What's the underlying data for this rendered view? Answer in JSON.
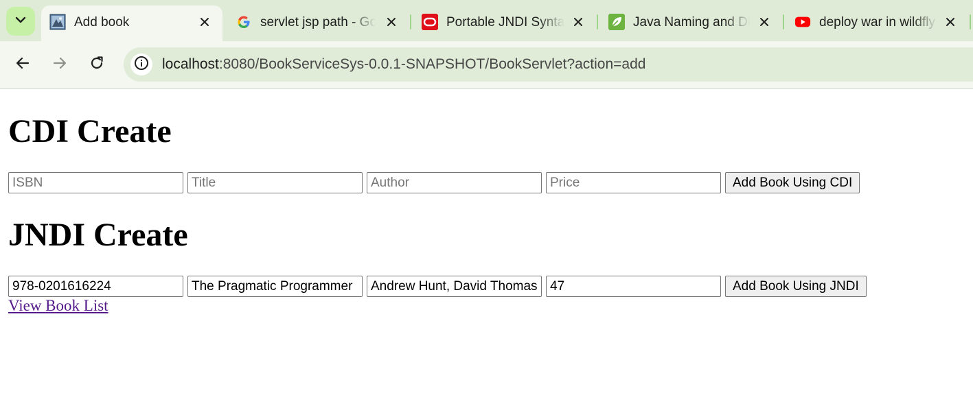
{
  "browser": {
    "tabs": [
      {
        "title": "Add book",
        "favicon": "page-favicon-icon",
        "active": true
      },
      {
        "title": "servlet jsp path - Google",
        "favicon": "google-favicon-icon",
        "active": false
      },
      {
        "title": "Portable JNDI Syntax",
        "favicon": "oracle-favicon-icon",
        "active": false
      },
      {
        "title": "Java Naming and Directory",
        "favicon": "spring-leaf-favicon-icon",
        "active": false
      },
      {
        "title": "deploy war in wildfly",
        "favicon": "youtube-favicon-icon",
        "active": false
      }
    ],
    "address": {
      "host": "localhost",
      "path": ":8080/BookServiceSys-0.0.1-SNAPSHOT/BookServlet?action=add"
    },
    "colors": {
      "tabstrip": "#dfebd6",
      "toolbar": "#f3f7ef",
      "omnibox": "#e0ebd8",
      "tab_search": "#c6f0a6",
      "separator": "#9fd58a"
    }
  },
  "page": {
    "cdi_heading": "CDI Create",
    "cdi_form": {
      "isbn_placeholder": "ISBN",
      "title_placeholder": "Title",
      "author_placeholder": "Author",
      "price_placeholder": "Price",
      "isbn_value": "",
      "title_value": "",
      "author_value": "",
      "price_value": "",
      "submit_label": "Add Book Using CDI"
    },
    "jndi_heading": "JNDI Create",
    "jndi_form": {
      "isbn_value": "978-0201616224",
      "title_value": "The Pragmatic Programmer",
      "author_value": "Andrew Hunt, David Thomas",
      "price_value": "47",
      "submit_label": "Add Book Using JNDI"
    },
    "book_list_link": "View Book List"
  }
}
